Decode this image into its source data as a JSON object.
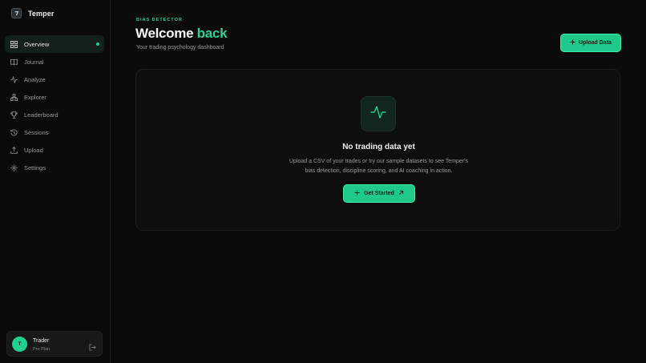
{
  "brand": {
    "name": "Temper",
    "logo_icon": "temper-logo-icon"
  },
  "sidebar": {
    "items": [
      {
        "label": "Overview",
        "icon": "grid-icon",
        "active": true
      },
      {
        "label": "Journal",
        "icon": "book-icon",
        "active": false
      },
      {
        "label": "Analyze",
        "icon": "activity-icon",
        "active": false
      },
      {
        "label": "Explorer",
        "icon": "network-icon",
        "active": false
      },
      {
        "label": "Leaderboard",
        "icon": "trophy-icon",
        "active": false
      },
      {
        "label": "Sessions",
        "icon": "history-icon",
        "active": false
      },
      {
        "label": "Upload",
        "icon": "upload-icon",
        "active": false
      },
      {
        "label": "Settings",
        "icon": "gear-icon",
        "active": false
      }
    ]
  },
  "user": {
    "initial": "T",
    "name": "Trader",
    "plan": "Pro Plan"
  },
  "header": {
    "eyebrow": "BIAS DETECTOR",
    "title_main": "Welcome",
    "title_accent": "back",
    "subtitle": "Your trading psychology dashboard",
    "upload_label": "Upload Data"
  },
  "empty_state": {
    "title": "No trading data yet",
    "desc_line1": "Upload a CSV of your trades or try our sample datasets to see Temper's",
    "desc_line2": "bias detection, discipline scoring, and AI coaching in action.",
    "cta_label": "Get Started"
  },
  "colors": {
    "accent": "#1ed18f",
    "background": "#0b0b0b",
    "card": "#0e0e0e"
  }
}
